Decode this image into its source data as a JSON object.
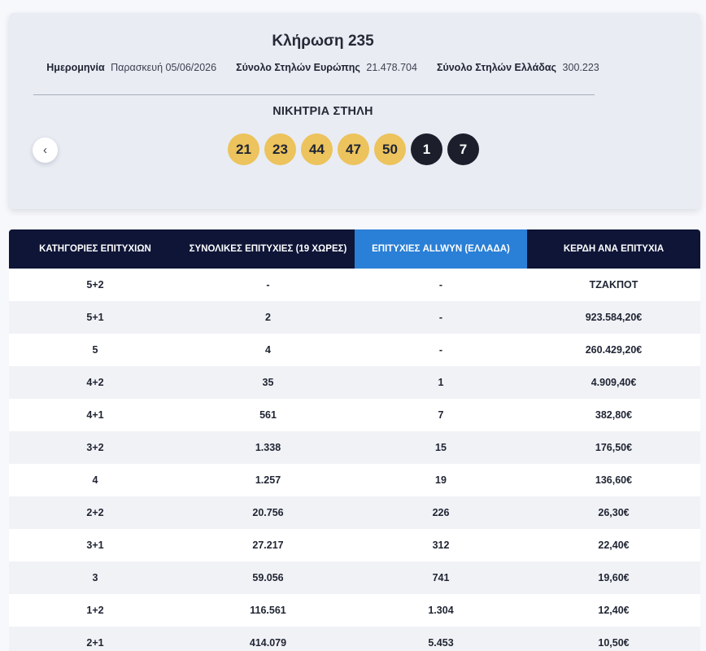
{
  "draw": {
    "title": "Κλήρωση 235",
    "date_label": "Ημερομηνία",
    "date_value": "Παρασκευή 05/06/2026",
    "europe_label": "Σύνολο Στηλών Ευρώπης",
    "europe_value": "21.478.704",
    "greece_label": "Σύνολο Στηλών Ελλάδας",
    "greece_value": "300.223",
    "winning_label": "ΝΙΚΗΤΡΙΑ ΣΤΗΛΗ",
    "main_numbers": [
      "21",
      "23",
      "44",
      "47",
      "50"
    ],
    "bonus_numbers": [
      "1",
      "7"
    ],
    "prev_icon": "‹"
  },
  "table": {
    "headers": [
      "ΚΑΤΗΓΟΡΙΕΣ ΕΠΙΤΥΧΙΩΝ",
      "ΣΥΝΟΛΙΚΕΣ ΕΠΙΤΥΧΙΕΣ (19 ΧΩΡΕΣ)",
      "ΕΠΙΤΥΧΙΕΣ ALLWYN (ΕΛΛΑΔΑ)",
      "ΚΕΡΔΗ ΑΝΑ ΕΠΙΤΥΧΙΑ"
    ],
    "rows": [
      [
        "5+2",
        "-",
        "-",
        "ΤΖΑΚΠΟΤ"
      ],
      [
        "5+1",
        "2",
        "-",
        "923.584,20€"
      ],
      [
        "5",
        "4",
        "-",
        "260.429,20€"
      ],
      [
        "4+2",
        "35",
        "1",
        "4.909,40€"
      ],
      [
        "4+1",
        "561",
        "7",
        "382,80€"
      ],
      [
        "3+2",
        "1.338",
        "15",
        "176,50€"
      ],
      [
        "4",
        "1.257",
        "19",
        "136,60€"
      ],
      [
        "2+2",
        "20.756",
        "226",
        "26,30€"
      ],
      [
        "3+1",
        "27.217",
        "312",
        "22,40€"
      ],
      [
        "3",
        "59.056",
        "741",
        "19,60€"
      ],
      [
        "1+2",
        "116.561",
        "1.304",
        "12,40€"
      ],
      [
        "2+1",
        "414.079",
        "5.453",
        "10,50€"
      ]
    ]
  }
}
